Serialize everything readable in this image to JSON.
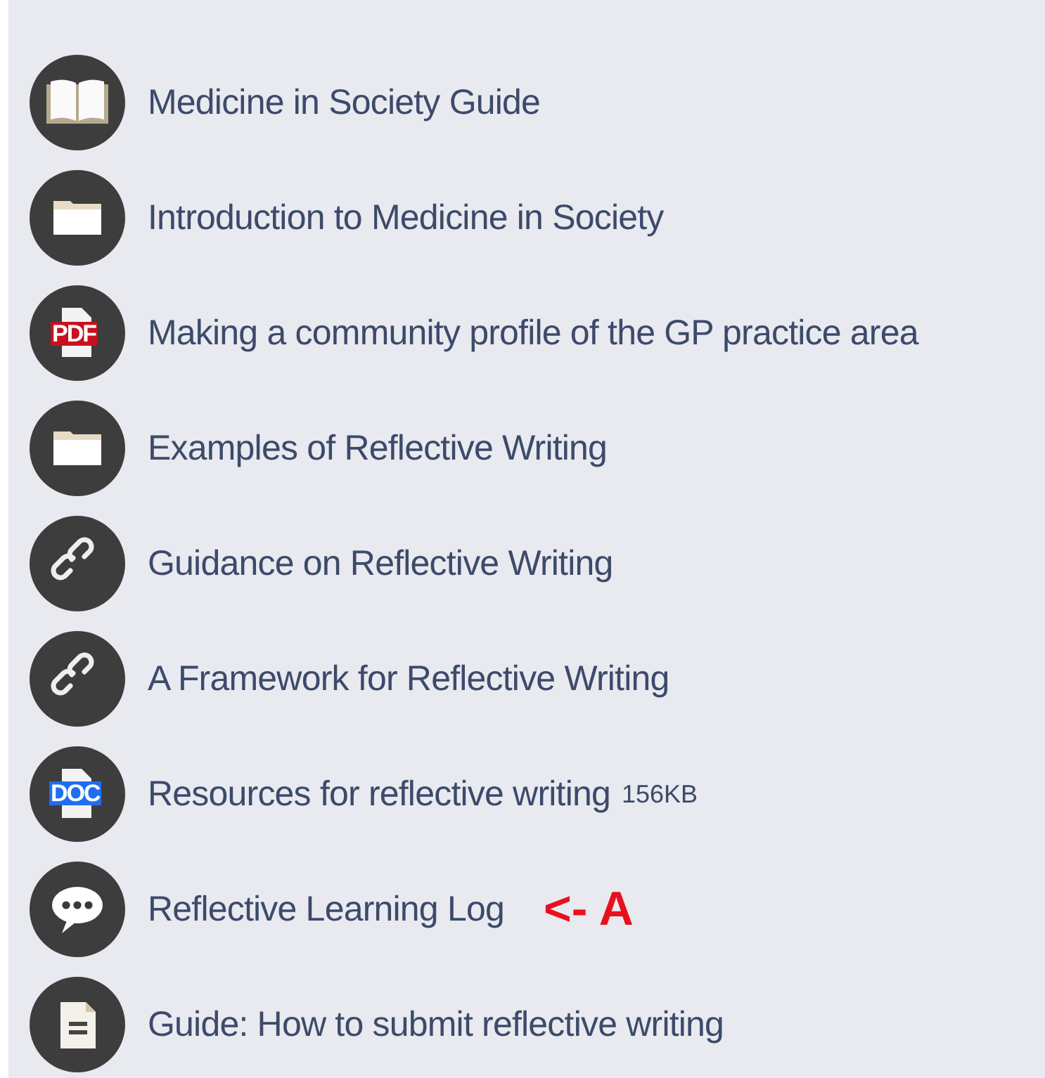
{
  "items": [
    {
      "kind": "book",
      "label": "Medicine in Society Guide"
    },
    {
      "kind": "folder",
      "label": "Introduction to Medicine in Society"
    },
    {
      "kind": "pdf",
      "badge": "PDF",
      "label": "Making a community profile of the GP practice area"
    },
    {
      "kind": "folder",
      "label": "Examples of Reflective Writing"
    },
    {
      "kind": "link",
      "label": "Guidance on Reflective Writing"
    },
    {
      "kind": "link",
      "label": "A Framework for Reflective Writing"
    },
    {
      "kind": "doc",
      "badge": "DOC",
      "label": "Resources for reflective writing",
      "size": "156KB"
    },
    {
      "kind": "chat",
      "label": "Reflective Learning Log",
      "annotation": "<- A"
    },
    {
      "kind": "page",
      "label": "Guide: How to submit reflective writing"
    }
  ]
}
